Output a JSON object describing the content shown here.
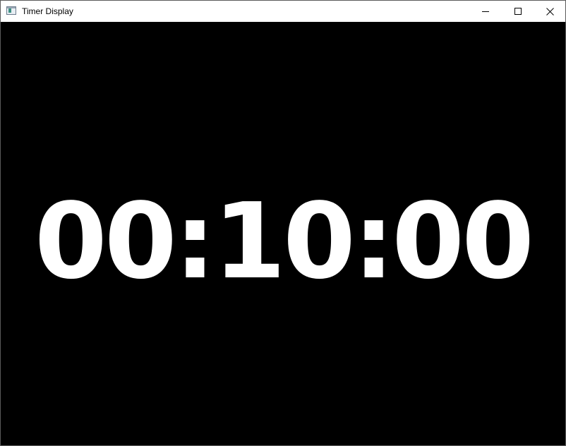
{
  "window": {
    "title": "Timer Display",
    "icon": "app-window-icon",
    "controls": [
      "minimize-icon",
      "maximize-icon",
      "close-icon"
    ]
  },
  "timer": {
    "display": "00:10:00"
  },
  "colors": {
    "background": "#000000",
    "timer_text": "#ffffff",
    "titlebar": "#ffffff"
  }
}
